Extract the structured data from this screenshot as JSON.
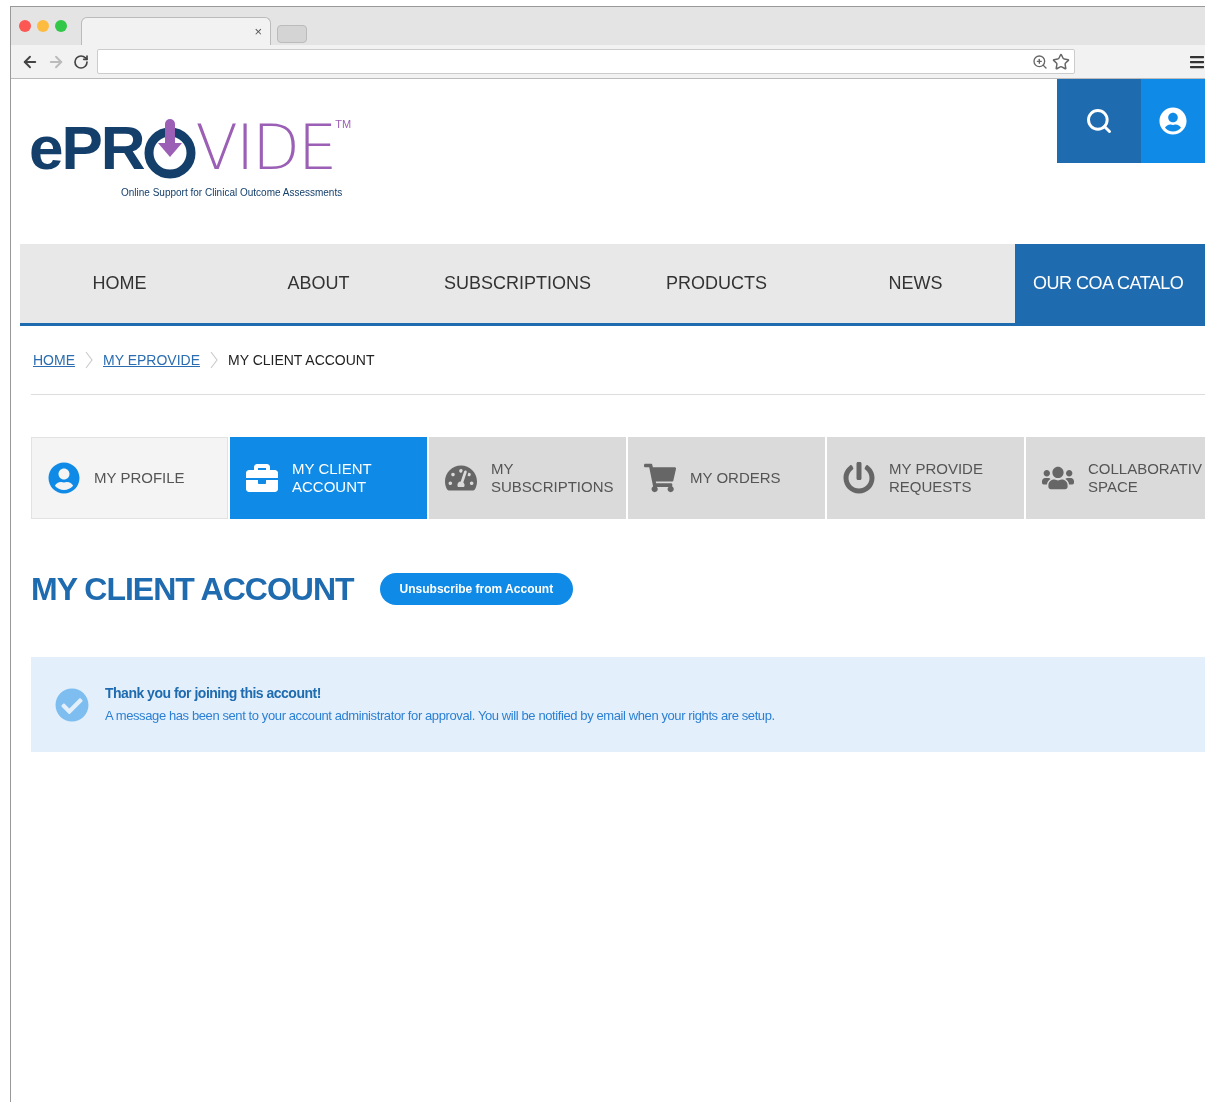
{
  "browser": {
    "tab_close": "×"
  },
  "logo": {
    "left": "ePR",
    "right": "VIDE",
    "mark": "TM",
    "tagline": "Online Support for Clinical Outcome Assessments"
  },
  "nav": [
    {
      "label": "HOME",
      "selected": false
    },
    {
      "label": "ABOUT",
      "selected": false
    },
    {
      "label": "SUBSCRIPTIONS",
      "selected": false
    },
    {
      "label": "PRODUCTS",
      "selected": false
    },
    {
      "label": "NEWS",
      "selected": false
    },
    {
      "label": "OUR COA CATALO",
      "selected": true
    }
  ],
  "breadcrumb": [
    {
      "label": "HOME",
      "kind": "link"
    },
    {
      "label": "MY EPROVIDE",
      "kind": "link"
    },
    {
      "label": "MY CLIENT ACCOUNT",
      "kind": "current"
    }
  ],
  "tabs": [
    {
      "label": "MY PROFILE",
      "kind": "profile",
      "selected": false
    },
    {
      "label": "MY CLIENT ACCOUNT",
      "kind": "account",
      "selected": true
    },
    {
      "label": "MY SUBSCRIPTIONS",
      "kind": "subscriptions",
      "selected": false
    },
    {
      "label": "MY ORDERS",
      "kind": "orders",
      "selected": false
    },
    {
      "label": "MY PROVIDE REQUESTS",
      "kind": "requests",
      "selected": false
    },
    {
      "label": "COLLABORATIV SPACE",
      "kind": "collab",
      "selected": false
    }
  ],
  "heading": "MY CLIENT ACCOUNT",
  "unsubscribe_button": "Unsubscribe from Account",
  "notice": {
    "title": "Thank you for joining this account!",
    "message": "A message has been sent to your account administrator for approval. You will be notified by email when your rights are setup."
  }
}
